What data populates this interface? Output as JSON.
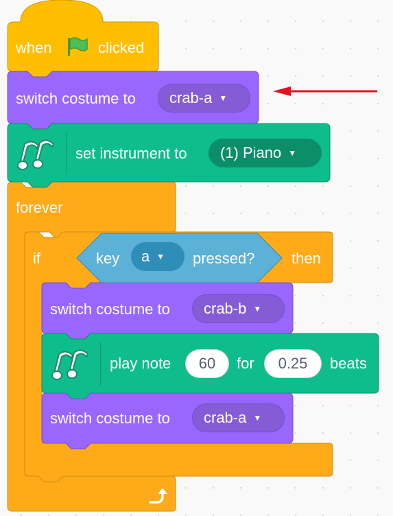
{
  "script": {
    "hat": {
      "when": "when",
      "flag_icon": "green-flag-icon",
      "clicked": "clicked"
    },
    "switch_costume_1": {
      "label": "switch costume to",
      "costume": "crab-a"
    },
    "set_instrument": {
      "label": "set instrument to",
      "instrument": "(1) Piano"
    },
    "forever": {
      "label": "forever",
      "loop_icon": "loop-arrow-icon"
    },
    "if_block": {
      "if_label": "if",
      "key_label": "key",
      "key_value": "a",
      "pressed_label": "pressed?",
      "then_label": "then"
    },
    "switch_costume_2": {
      "label": "switch costume to",
      "costume": "crab-b"
    },
    "play_note": {
      "label": "play note",
      "note": "60",
      "for_label": "for",
      "beats_value": "0.25",
      "beats_label": "beats"
    },
    "switch_costume_3": {
      "label": "switch costume to",
      "costume": "crab-a"
    }
  },
  "colors": {
    "events": "#ffbf00",
    "looks": "#9966ff",
    "music": "#0fbd8c",
    "control": "#ffab19",
    "sensing": "#5cb1d6",
    "annotation_arrow": "#e0141e"
  }
}
